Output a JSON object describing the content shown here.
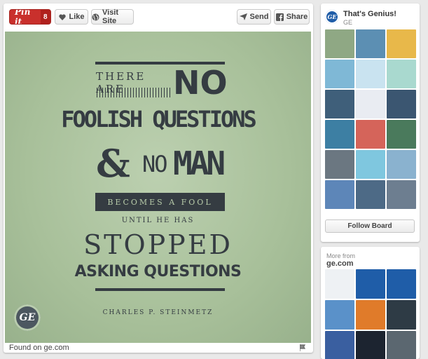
{
  "toolbar": {
    "pinit_label": "Pin it",
    "pinit_count": "8",
    "like_label": "Like",
    "visit_label": "Visit Site",
    "send_label": "Send",
    "share_label": "Share"
  },
  "quote": {
    "line1": "THERE ARE",
    "line1_big": "NO",
    "line2": "FOOLISH QUESTIONS",
    "line3_amp": "&",
    "line3_no": "NO",
    "line3_man": "MAN",
    "line4": "BECOMES A FOOL",
    "line5": "UNTIL HE HAS",
    "line6": "STOPPED",
    "line7": "ASKING QUESTIONS",
    "author": "CHARLES P. STEINMETZ",
    "logo_text": "GE"
  },
  "pin_footer": {
    "found_on": "Found on ge.com"
  },
  "board": {
    "title": "That's Genius!",
    "owner": "GE",
    "follow_label": "Follow Board",
    "thumb_colors": [
      "#8fa884",
      "#5c8fb3",
      "#e8b84a",
      "#7fb8d6",
      "#c9e3f0",
      "#a9d9cf",
      "#3f5f7a",
      "#e9ecf2",
      "#3b5671",
      "#3d7fa3",
      "#d5645a",
      "#4a7a5c",
      "#6b7781",
      "#7fc7df",
      "#8ab2cf",
      "#5d86b8",
      "#4d6a86",
      "#6d7e90"
    ]
  },
  "more_from": {
    "label": "More from",
    "site": "ge.com",
    "thumb_colors": [
      "#eef1f4",
      "#1f5da8",
      "#1f5da8",
      "#5a91c9",
      "#e07b2a",
      "#2e3b45",
      "#3a5fa0",
      "#1c2430",
      "#5b6770"
    ]
  }
}
